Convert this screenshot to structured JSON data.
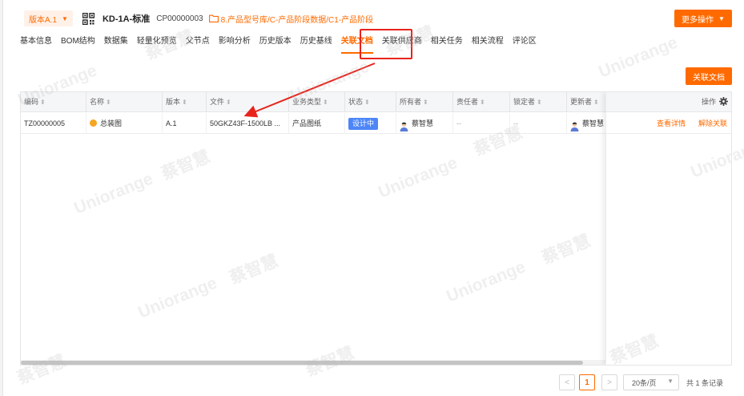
{
  "header": {
    "version_label": "版本A.1",
    "product_name": "KD-1A-标准",
    "product_code": "CP00000003",
    "path": "8.产品型号库/C-产品阶段数据/C1-产品阶段",
    "more_actions_label": "更多操作"
  },
  "tabs": [
    {
      "label": "基本信息"
    },
    {
      "label": "BOM结构"
    },
    {
      "label": "数据集"
    },
    {
      "label": "轻量化预览"
    },
    {
      "label": "父节点"
    },
    {
      "label": "影响分析"
    },
    {
      "label": "历史版本"
    },
    {
      "label": "历史基线"
    },
    {
      "label": "关联文档"
    },
    {
      "label": "关联供应商"
    },
    {
      "label": "相关任务"
    },
    {
      "label": "相关流程"
    },
    {
      "label": "评论区"
    }
  ],
  "active_tab": "关联文档",
  "toolbar": {
    "link_doc_label": "关联文档"
  },
  "table": {
    "columns": [
      "编码",
      "名称",
      "版本",
      "文件",
      "业务类型",
      "状态",
      "所有者",
      "责任者",
      "锁定者",
      "更新者"
    ],
    "ops_header": "操作",
    "rows": [
      {
        "code": "TZ00000005",
        "name": "总装图",
        "version": "A.1",
        "file": "50GKZ43F-1500LB ...",
        "business_type": "产品图纸",
        "status": "设计中",
        "owner": "蔡智慧",
        "responsible": "--",
        "locker": "--",
        "updater": "蔡智慧",
        "action_view": "查看详情",
        "action_unlink": "解除关联"
      }
    ]
  },
  "pagination": {
    "prev": "<",
    "current_page": "1",
    "next": ">",
    "page_size": "20条/页",
    "total": "共 1 条记录"
  },
  "colors": {
    "accent": "#ff6a00",
    "status_blue": "#4d86f7",
    "annotation_red": "#e8231b"
  },
  "watermarks": [
    "Uniorange",
    "蔡智慧"
  ]
}
